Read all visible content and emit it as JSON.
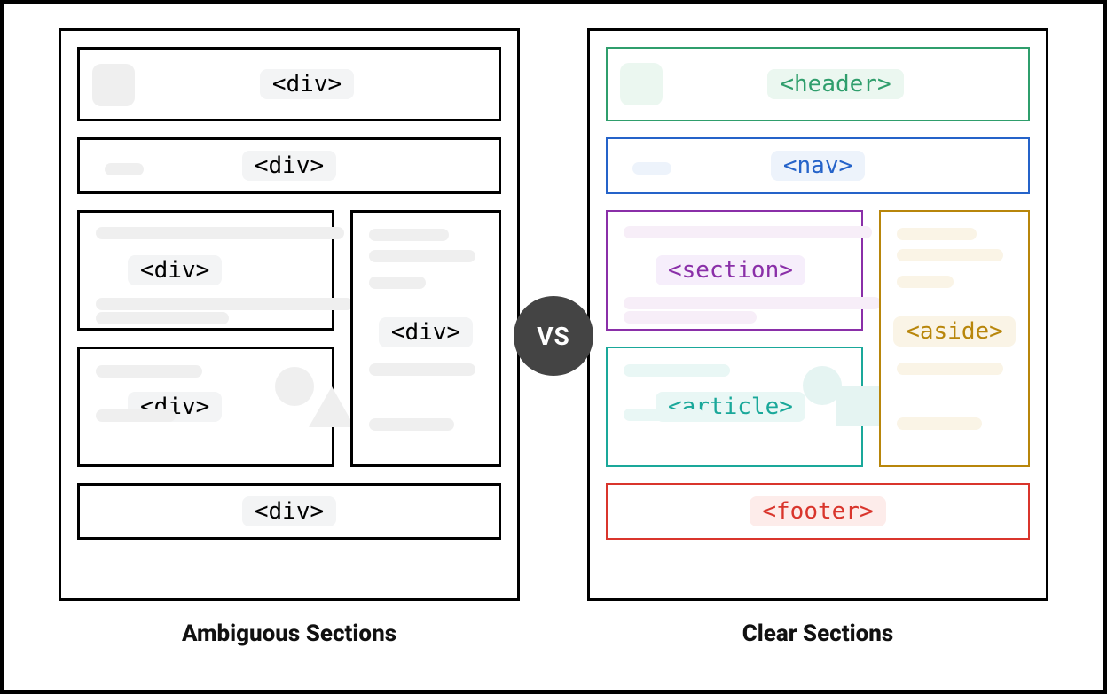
{
  "vs_label": "VS",
  "left": {
    "caption": "Ambiguous Sections",
    "header": "<div>",
    "nav": "<div>",
    "section": "<div>",
    "article": "<div>",
    "aside": "<div>",
    "footer": "<div>"
  },
  "right": {
    "caption": "Clear Sections",
    "header": "<header>",
    "nav": "<nav>",
    "section": "<section>",
    "article": "<article>",
    "aside": "<aside>",
    "footer": "<footer>"
  },
  "colors": {
    "header": "#2f9e6c",
    "nav": "#2563c9",
    "section": "#8a2fa8",
    "article": "#1aa89a",
    "aside": "#b8860b",
    "footer": "#d9352c"
  }
}
